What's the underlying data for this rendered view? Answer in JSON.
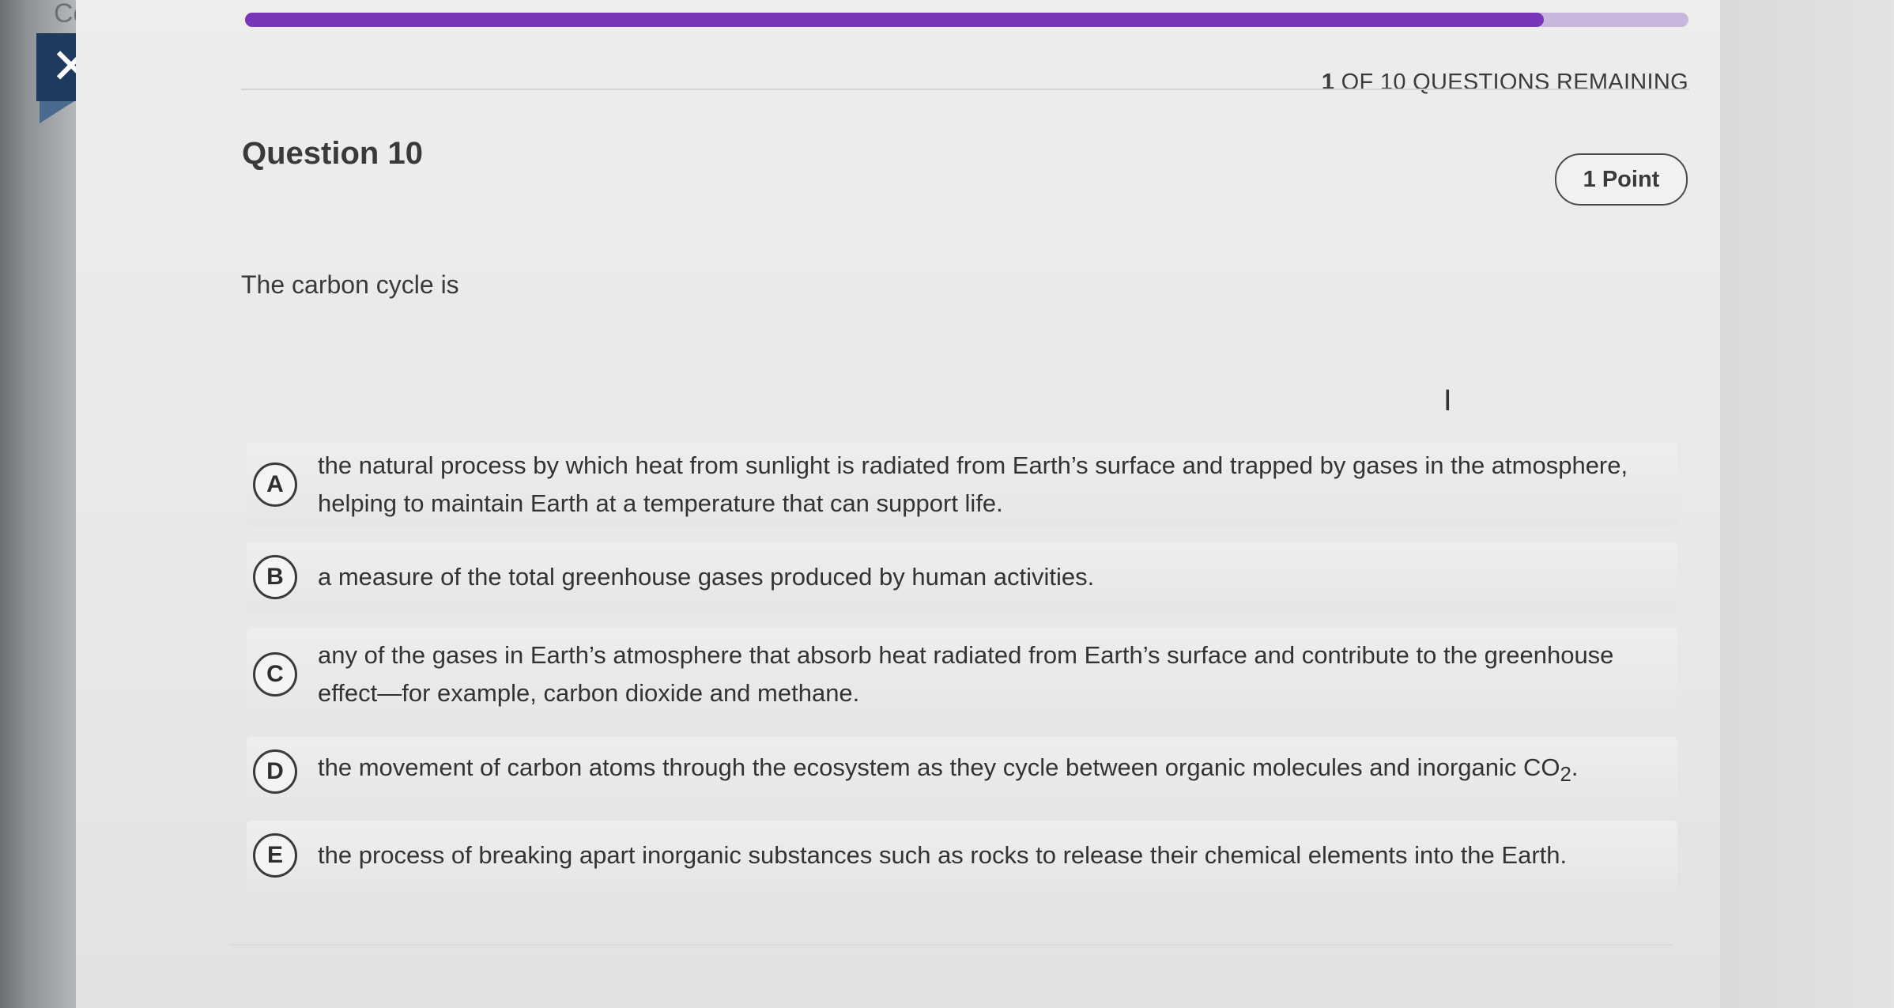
{
  "header": {
    "corner_text": "Cc",
    "close_label": "✕",
    "progress_fraction": 0.9,
    "progress_color": "#7a36b8",
    "progress_track_color": "#c9b6dc",
    "remaining_count": "1",
    "remaining_label": "OF 10 QUESTIONS REMAINING"
  },
  "question": {
    "title": "Question 10",
    "points": "1 Point",
    "prompt": "The carbon cycle is"
  },
  "options": [
    {
      "letter": "A",
      "text": "the natural process by which heat from sunlight is radiated from Earth’s surface and trapped by gases in the atmosphere, helping to maintain Earth at a temperature that can support life."
    },
    {
      "letter": "B",
      "text": "a measure of the total greenhouse gases produced by human activities."
    },
    {
      "letter": "C",
      "text": "any of the gases in Earth’s atmosphere that absorb heat radiated from Earth’s surface and contribute to the greenhouse effect—for example, carbon dioxide and methane."
    },
    {
      "letter": "D",
      "text_before": "the movement of carbon atoms through the ecosystem as they cycle between organic molecules and inorganic CO",
      "subscript": "2",
      "text_after": "."
    },
    {
      "letter": "E",
      "text": "the process of breaking apart inorganic substances such as rocks to release their chemical elements into the Earth."
    }
  ],
  "cursor_glyph": "I",
  "accent_color": "#1f3a5f"
}
